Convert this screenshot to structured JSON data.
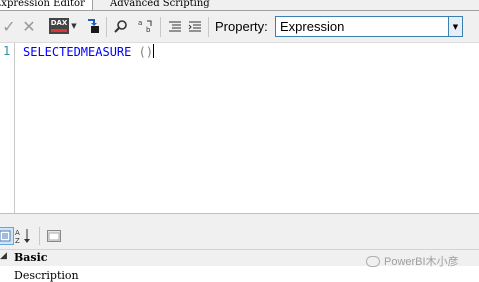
{
  "tabs": [
    "Expression Editor",
    "Advanced Scripting"
  ],
  "toolbar": {
    "accept_icon": "checkmark-icon",
    "cancel_icon": "x-icon",
    "dax_badge": "DAX",
    "property_label": "Property:",
    "property_value": "Expression"
  },
  "editor": {
    "line_number": "1",
    "code_function": "SELECTEDMEASURE",
    "code_parens": " ()"
  },
  "properties": {
    "category": "Basic",
    "row_label": "Description"
  },
  "watermark": "PowerBI木小彦",
  "colors": {
    "keyword": "#0000ff",
    "line_number": "#2b91af",
    "select_border": "#3c7fb1"
  }
}
